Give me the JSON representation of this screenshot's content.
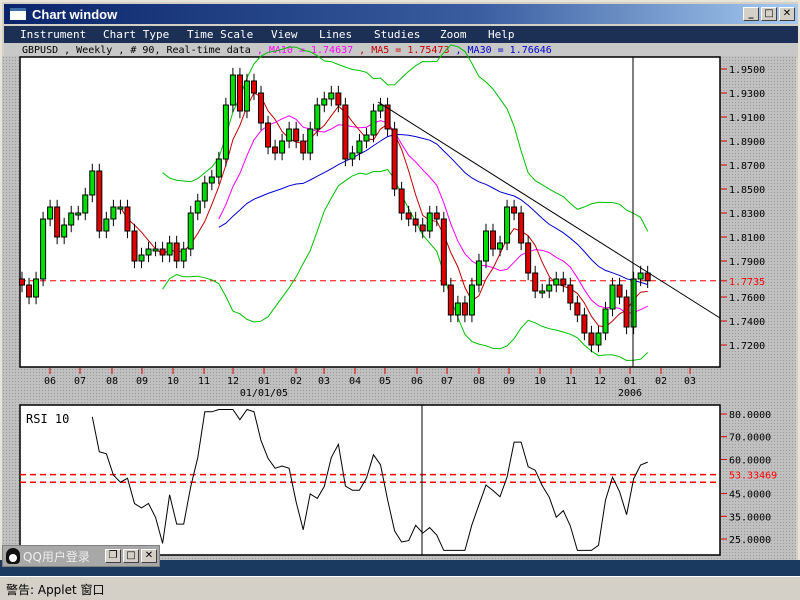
{
  "window": {
    "title": "Chart window",
    "min": "_",
    "max": "□",
    "close": "✕"
  },
  "menu": [
    "Instrument",
    "Chart Type",
    "Time Scale",
    "View",
    "Lines",
    "Studies",
    "Zoom",
    "Help"
  ],
  "info": {
    "prefix": "GBPUSD , Weekly , # 90, Real-time data ",
    "ma10": ", MA10 = 1.74637 ",
    "ma5": ", MA5 = 1.75473 ",
    "ma30": ", MA30 = 1.76646"
  },
  "colors": {
    "up": "#00e000",
    "down": "#e00000",
    "ma5": "#c00000",
    "ma10": "#ff00ff",
    "ma30": "#0000d0",
    "bands": "#00c000",
    "level": "#ff0000"
  },
  "chart_data": {
    "type": "candlestick",
    "symbol": "GBPUSD",
    "period": "Weekly",
    "bars": 90,
    "ylim": [
      1.7,
      1.96
    ],
    "y_ticks": [
      "1.9500",
      "1.9300",
      "1.9100",
      "1.8900",
      "1.8700",
      "1.8500",
      "1.8300",
      "1.8100",
      "1.7900",
      "1.7600",
      "1.7400",
      "1.7200"
    ],
    "current_level": "1.7735",
    "x_ticks": [
      "06",
      "07",
      "08",
      "09",
      "10",
      "11",
      "12",
      "01",
      "02",
      "03",
      "04",
      "05",
      "06",
      "07",
      "08",
      "09",
      "10",
      "11",
      "12",
      "01",
      "02",
      "03"
    ],
    "x_year_labels": [
      "01/01/05",
      "2006"
    ],
    "closes": [
      1.77,
      1.76,
      1.775,
      1.825,
      1.835,
      1.81,
      1.82,
      1.83,
      1.83,
      1.845,
      1.865,
      1.815,
      1.825,
      1.835,
      1.835,
      1.815,
      1.79,
      1.795,
      1.8,
      1.8,
      1.795,
      1.805,
      1.79,
      1.8,
      1.83,
      1.84,
      1.855,
      1.86,
      1.875,
      1.92,
      1.945,
      1.915,
      1.94,
      1.93,
      1.905,
      1.885,
      1.88,
      1.89,
      1.9,
      1.89,
      1.88,
      1.9,
      1.92,
      1.925,
      1.93,
      1.92,
      1.875,
      1.88,
      1.89,
      1.895,
      1.915,
      1.92,
      1.9,
      1.85,
      1.83,
      1.825,
      1.82,
      1.815,
      1.83,
      1.825,
      1.77,
      1.745,
      1.755,
      1.745,
      1.77,
      1.79,
      1.815,
      1.8,
      1.805,
      1.835,
      1.83,
      1.805,
      1.78,
      1.765,
      1.765,
      1.77,
      1.775,
      1.77,
      1.755,
      1.745,
      1.73,
      1.72,
      1.73,
      1.75,
      1.77,
      1.76,
      1.735,
      1.775,
      1.78,
      1.7735
    ],
    "rsi": {
      "label": "RSI 10",
      "y_ticks": [
        "80.0000",
        "70.0000",
        "60.0000",
        "45.0000",
        "35.0000",
        "25.0000"
      ],
      "current": "53.33469",
      "levels": [
        53.33469,
        50
      ]
    }
  },
  "status": "警告: Applet 窗口",
  "qq": {
    "title": "QQ用户登录"
  }
}
